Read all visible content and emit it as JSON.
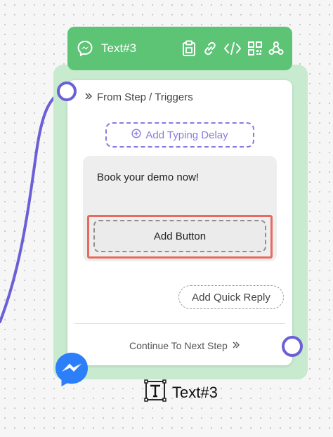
{
  "node": {
    "title": "Text#3",
    "from_step_label": "From Step / Triggers",
    "typing_delay_label": "Add Typing Delay",
    "message_text": "Book your demo now!",
    "add_button_label": "Add Button",
    "quick_reply_label": "Add Quick Reply",
    "continue_label": "Continue To Next Step"
  },
  "footer": {
    "label": "Text#3"
  },
  "header_tools": [
    "clipboard-icon",
    "link-icon",
    "code-icon",
    "qr-code-icon",
    "webhook-icon"
  ],
  "colors": {
    "header": "#5cc474",
    "node_background": "#c8ebd0",
    "accent": "#6b5fd8",
    "highlight": "#e86a5e",
    "messenger": "#2d7ff9"
  }
}
